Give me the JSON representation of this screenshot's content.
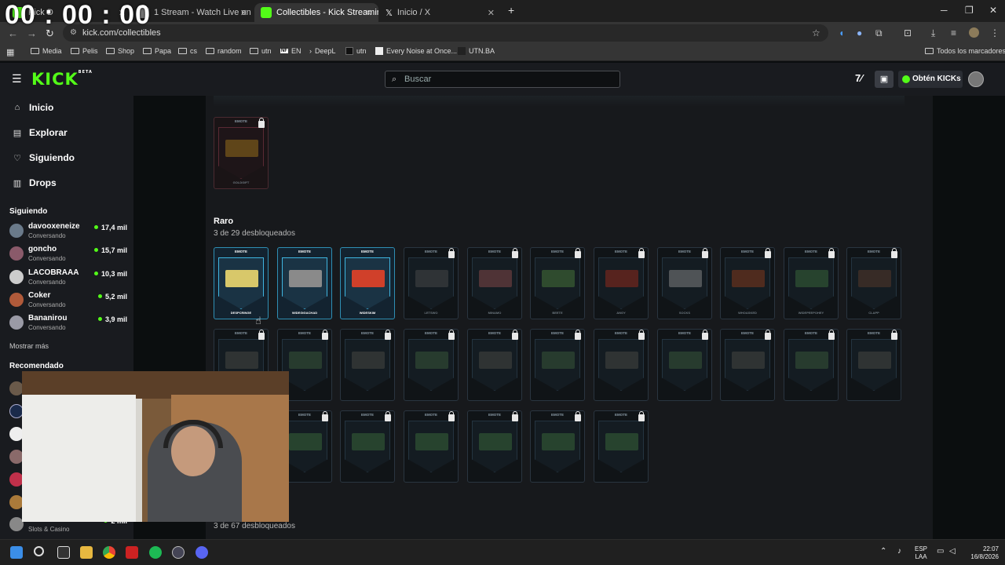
{
  "timer": "00 : 00 : 00",
  "tabs": [
    {
      "label": "Kick D",
      "active": false
    },
    {
      "label": "1 Stream - Watch Live on",
      "active": false
    },
    {
      "label": "Collectibles - Kick Streaming",
      "active": true
    },
    {
      "label": "Inicio / X",
      "active": false
    }
  ],
  "new_tab": "+",
  "window": {
    "minimize": "─",
    "restore": "❐",
    "close": "✕"
  },
  "address": {
    "url": "kick.com/collectibles"
  },
  "bookmarks": [
    "Media",
    "Pelis",
    "Shop",
    "Papa",
    "cs",
    "random",
    "utn",
    "EN",
    "DeepL",
    "utn",
    "Every Noise at Once...",
    "UTN.BA"
  ],
  "bookmarks_right": "Todos los marcadores",
  "header": {
    "logo": "KICK",
    "logo_beta": "BETA",
    "search_placeholder": "Buscar",
    "get_kicks": "Obtén KICKs"
  },
  "sidebar": {
    "nav": [
      {
        "label": "Inicio",
        "icon": "home-icon",
        "glyph": "⌂"
      },
      {
        "label": "Explorar",
        "icon": "explore-icon",
        "glyph": "▤"
      },
      {
        "label": "Siguiendo",
        "icon": "heart-icon",
        "glyph": "♡"
      },
      {
        "label": "Drops",
        "icon": "drops-icon",
        "glyph": "▥"
      }
    ],
    "following_title": "Siguiendo",
    "following": [
      {
        "name": "davooxeneize",
        "status": "Conversando",
        "viewers": "17,4 mil"
      },
      {
        "name": "goncho",
        "status": "Conversando",
        "viewers": "15,7 mil"
      },
      {
        "name": "LACOBRAAA",
        "status": "Conversando",
        "viewers": "10,3 mil"
      },
      {
        "name": "Coker",
        "status": "Conversando",
        "viewers": "5,2 mil"
      },
      {
        "name": "Bananirou",
        "status": "Conversando",
        "viewers": "3,9 mil"
      }
    ],
    "show_more": "Mostrar más",
    "recommended_title": "Recomendado",
    "recommended_last": {
      "name": "",
      "status": "Slots & Casino",
      "viewers": "2 mil"
    }
  },
  "collectibles": {
    "top_card": {
      "tag": "EMOTE",
      "name": "GOLDGIFT"
    },
    "rare_title": "Raro",
    "rare_sub": "3 de 29 desbloqueados",
    "rare_cards": [
      {
        "name": "DESPCRINGE",
        "unlocked": true
      },
      {
        "name": "WIDEGIGACHAD",
        "unlocked": true
      },
      {
        "name": "WIDESKIM",
        "unlocked": true
      },
      {
        "name": "LETSWO",
        "unlocked": false
      },
      {
        "name": "MINAMO",
        "unlocked": false
      },
      {
        "name": "BEETE",
        "unlocked": false
      },
      {
        "name": "ANGY",
        "unlocked": false
      },
      {
        "name": "SOCKS",
        "unlocked": false
      },
      {
        "name": "WHOASKED",
        "unlocked": false
      },
      {
        "name": "WIDEPEEPOHEY",
        "unlocked": false
      },
      {
        "name": "CLAPP",
        "unlocked": false
      }
    ],
    "card_tag": "EMOTE",
    "bottom_sub": "3 de 67 desbloqueados"
  },
  "taskbar": {
    "lang": "ESP",
    "lang2": "LAA",
    "time": "22:07",
    "date": "16/8/2026"
  }
}
